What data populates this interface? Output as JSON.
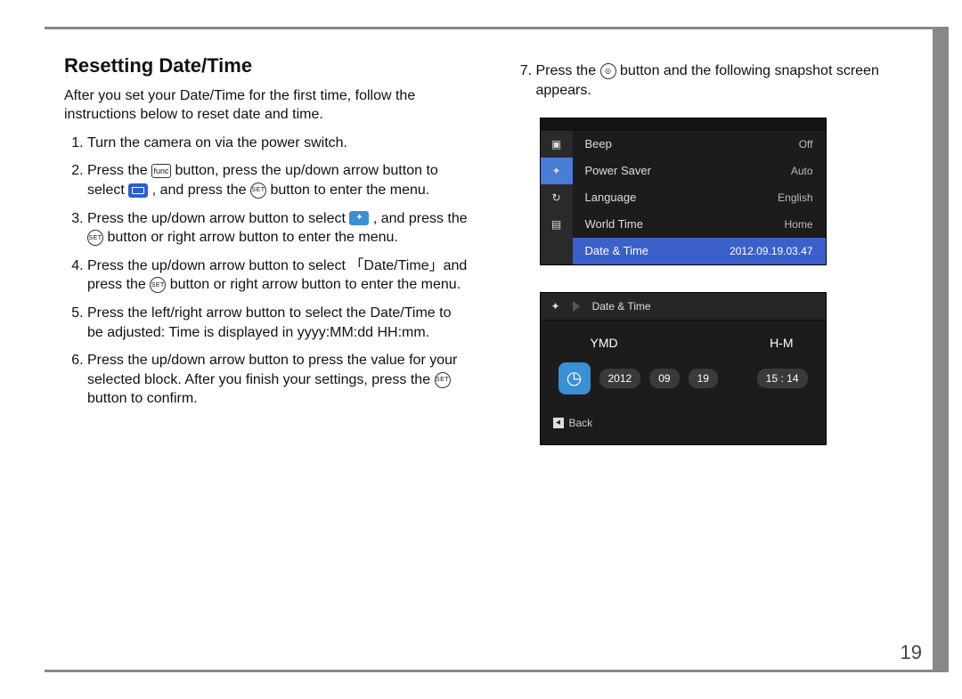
{
  "section_title": "Resetting Date/Time",
  "intro": "After you set your Date/Time for the first time, follow the instructions below to reset date and time.",
  "steps_left": {
    "s1": "Turn the camera on via the power switch.",
    "s2a": "Press the ",
    "s2b": " button, press the up/down arrow button to select ",
    "s2c": " , and press the ",
    "s2d": " button to enter the menu.",
    "s3a": "Press the up/down arrow button to select ",
    "s3b": " , and press the ",
    "s3c": " button or right arrow button to enter the menu.",
    "s4a": "Press the up/down arrow button to select 「Date/Time」and press the ",
    "s4b": " button or right arrow button to enter the menu.",
    "s5": "Press the left/right arrow button to select the Date/Time to be adjusted: Time is displayed in yyyy:MM:dd HH:mm.",
    "s6a": "Press the up/down arrow button to press the value for your selected block. After you finish your settings, press the ",
    "s6b": " button to confirm."
  },
  "step7a": "Press the ",
  "step7b": " button and the following snapshot screen appears.",
  "set_label": "SET",
  "func_label": "func",
  "menu_screen": {
    "rows": [
      {
        "label": "Beep",
        "value": "Off"
      },
      {
        "label": "Power Saver",
        "value": "Auto"
      },
      {
        "label": "Language",
        "value": "English"
      },
      {
        "label": "World Time",
        "value": "Home"
      },
      {
        "label": "Date & Time",
        "value": "2012.09.19.03.47"
      }
    ]
  },
  "datetime_screen": {
    "crumb": "Date & Time",
    "head_left": "YMD",
    "head_right": "H-M",
    "year": "2012",
    "month": "09",
    "day": "19",
    "time": "15 : 14",
    "back": "Back"
  },
  "page_number": "19"
}
